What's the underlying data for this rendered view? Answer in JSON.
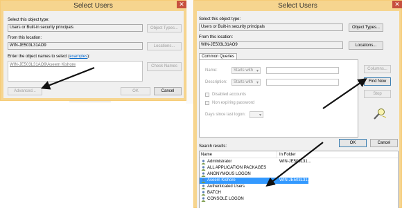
{
  "left_dialog": {
    "title": "Select Users",
    "close_glyph": "✕",
    "object_type_label": "Select this object type:",
    "object_type_value": "Users or Built-in security principals",
    "object_types_button": "Object Types...",
    "location_label": "From this location:",
    "location_value": "WIN-JE503L31AO9",
    "locations_button": "Locations...",
    "enter_names_label_prefix": "Enter the object names to select (",
    "enter_names_link": "examples",
    "enter_names_label_suffix": "):",
    "names_value": "WIN-JE503L31AO9\\Aseem Kishore",
    "check_names_button": "Check Names",
    "advanced_button": "Advanced...",
    "ok_button": "OK",
    "cancel_button": "Cancel"
  },
  "right_dialog": {
    "title": "Select Users",
    "close_glyph": "✕",
    "object_type_label": "Select this object type:",
    "object_type_value": "Users or Built-in security principals",
    "object_types_button": "Object Types...",
    "location_label": "From this location:",
    "location_value": "WIN-JE503L31AO9",
    "locations_button": "Locations...",
    "tab_label": "Common Queries",
    "name_label": "Name:",
    "name_mode": "Starts with",
    "description_label": "Description:",
    "description_mode": "Starts with",
    "disabled_accounts": "Disabled accounts",
    "non_expiring_password": "Non expiring password",
    "days_since_logon": "Days since last logon:",
    "columns_button": "Columns...",
    "find_now_button": "Find Now",
    "stop_button": "Stop",
    "ok_button": "OK",
    "cancel_button": "Cancel",
    "search_results_label": "Search results:",
    "col_name": "Name",
    "col_folder": "In Folder",
    "results": [
      {
        "name": "Administrator",
        "folder": "WIN-JE503L31..."
      },
      {
        "name": "ALL APPLICATION PACKAGES",
        "folder": ""
      },
      {
        "name": "ANONYMOUS LOGON",
        "folder": ""
      },
      {
        "name": "Aseem Kishore",
        "folder": "WIN-JE503L31..."
      },
      {
        "name": "Authenticated Users",
        "folder": ""
      },
      {
        "name": "BATCH",
        "folder": ""
      },
      {
        "name": "CONSOLE LOGON",
        "folder": ""
      }
    ],
    "selected_result_index": 3
  },
  "colors": {
    "title_bar": "#f6d58f",
    "close_button": "#c7503e",
    "selection": "#3399ff",
    "link": "#0066cc",
    "arrow": "#111111"
  }
}
